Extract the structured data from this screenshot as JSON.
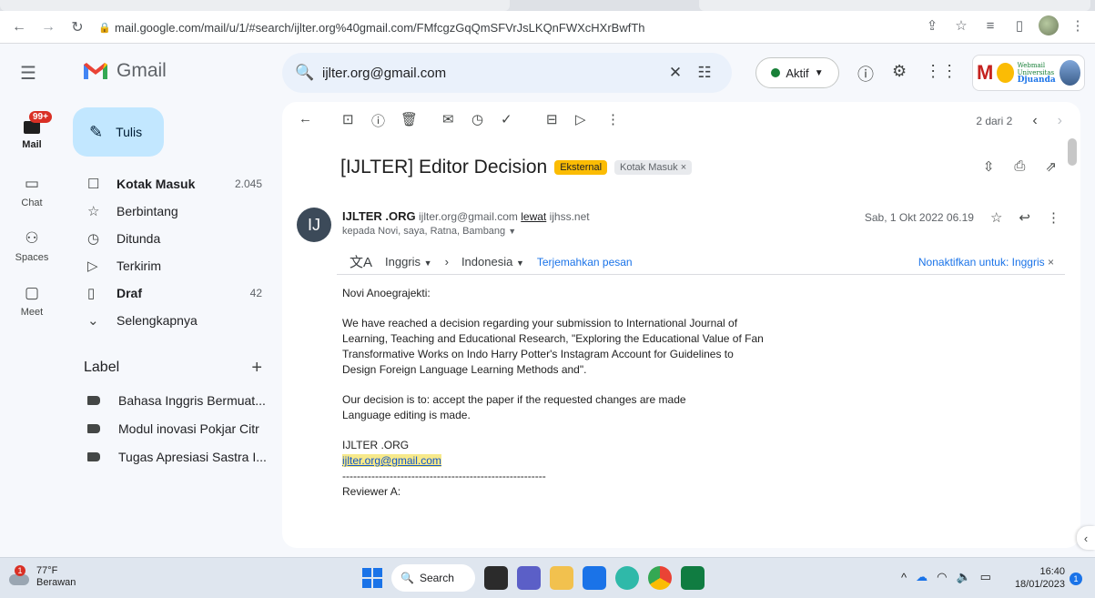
{
  "browser": {
    "url": "mail.google.com/mail/u/1/#search/ijlter.org%40gmail.com/FMfcgzGqQmSFVrJsLKQnFWXcHXrBwfTh",
    "back_icon": "arrow-left-icon",
    "forward_icon": "arrow-right-icon",
    "reload_icon": "reload-icon"
  },
  "header": {
    "brand": "Gmail",
    "search_value": "ijlter.org@gmail.com",
    "status": "Aktif",
    "status_color": "#188038",
    "workspace_logo": {
      "letter": "M",
      "line1": "Webmail",
      "line2": "Universitas",
      "line3": "Djuanda"
    }
  },
  "rail": {
    "mail_badge": "99+",
    "items": [
      {
        "label": "Mail"
      },
      {
        "label": "Chat"
      },
      {
        "label": "Spaces"
      },
      {
        "label": "Meet"
      }
    ]
  },
  "sidebar": {
    "compose_label": "Tulis",
    "items": [
      {
        "label": "Kotak Masuk",
        "count": "2.045"
      },
      {
        "label": "Berbintang",
        "count": ""
      },
      {
        "label": "Ditunda",
        "count": ""
      },
      {
        "label": "Terkirim",
        "count": ""
      },
      {
        "label": "Draf",
        "count": "42"
      },
      {
        "label": "Selengkapnya",
        "count": ""
      }
    ],
    "labels_title": "Label",
    "labels": [
      {
        "label": "Bahasa Inggris Bermuat..."
      },
      {
        "label": "Modul inovasi Pokjar Citr"
      },
      {
        "label": "Tugas Apresiasi Sastra I..."
      }
    ]
  },
  "message": {
    "pager": "2 dari 2",
    "subject": "[IJLTER] Editor Decision",
    "chip_external": "Eksternal",
    "chip_inbox": "Kotak Masuk",
    "chip_inbox_close": "×",
    "avatar_initials": "IJ",
    "sender_name": "IJLTER .ORG",
    "sender_email": "ijlter.org@gmail.com",
    "via_label": "lewat",
    "via_domain": "ijhss.net",
    "to_line": "kepada Novi, saya, Ratna, Bambang",
    "date": "Sab, 1 Okt 2022 06.19",
    "translate": {
      "from_lang": "Inggris",
      "to_lang": "Indonesia",
      "translate_link": "Terjemahkan pesan",
      "disable_link": "Nonaktifkan untuk: Inggris"
    },
    "body": {
      "greeting": "Novi Anoegrajekti:",
      "para1": "We have reached a decision regarding your submission to International Journal of Learning, Teaching and Educational Research, \"Exploring the Educational Value of Fan Transformative Works on Indo Harry Potter's Instagram Account for Guidelines to Design Foreign Language Learning Methods and\".",
      "para2_line1": "Our decision is to: accept the paper if the requested changes are made",
      "para2_line2": "Language editing is made.",
      "signature_name": "IJLTER .ORG",
      "signature_email": "ijlter.org@gmail.com",
      "separator": "--------------------------------------------------------",
      "reviewer": "Reviewer A:"
    }
  },
  "taskbar": {
    "temperature": "77°F",
    "weather": "Berawan",
    "weather_badge": "1",
    "search_label": "Search",
    "time": "16:40",
    "date": "18/01/2023",
    "notif_count": "1"
  }
}
